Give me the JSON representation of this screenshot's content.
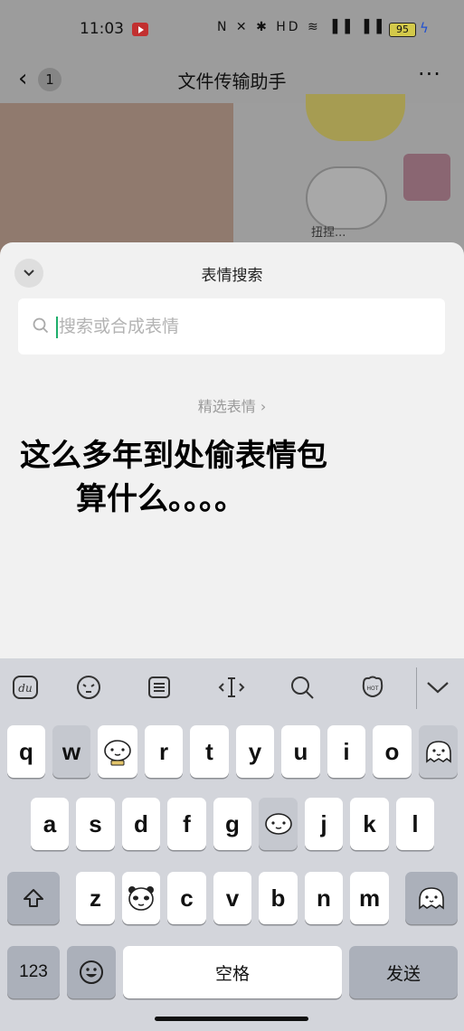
{
  "status_bar": {
    "time": "11:03",
    "system_icons": "N ✕ ✱ HD ≋ ▐▐ ▐▐",
    "battery": "95"
  },
  "chat_header": {
    "back_icon": "chevron-left-icon",
    "unread_count": "1",
    "title": "文件传输助手",
    "more_icon": "ellipsis-icon"
  },
  "chat": {
    "sticker_caption": "扭捏..."
  },
  "sticker_search": {
    "title": "表情搜索",
    "collapse_icon": "chevron-down-icon",
    "search_placeholder": "搜索或合成表情",
    "featured_link": "精选表情 ›"
  },
  "overlay_caption": {
    "line1": "这么多年到处偷表情包",
    "line2": "算什么。。。。"
  },
  "keyboard_toolbar": {
    "items": [
      "du-logo-icon",
      "emoji-face-icon",
      "clipboard-icon",
      "cursor-icon",
      "search-icon",
      "hot-sticker-icon",
      "collapse-keyboard-icon"
    ]
  },
  "keyboard": {
    "row1": [
      "q",
      "w",
      "",
      "r",
      "t",
      "y",
      "u",
      "i",
      "o",
      ""
    ],
    "row2": [
      "a",
      "s",
      "d",
      "f",
      "g",
      "",
      "j",
      "k",
      "l"
    ],
    "row3": [
      "",
      "z",
      "",
      "c",
      "v",
      "b",
      "n",
      "m",
      ""
    ],
    "numbers_key": "123",
    "space_key": "空格",
    "send_key": "发送",
    "accent_color": "#1fae6b"
  }
}
